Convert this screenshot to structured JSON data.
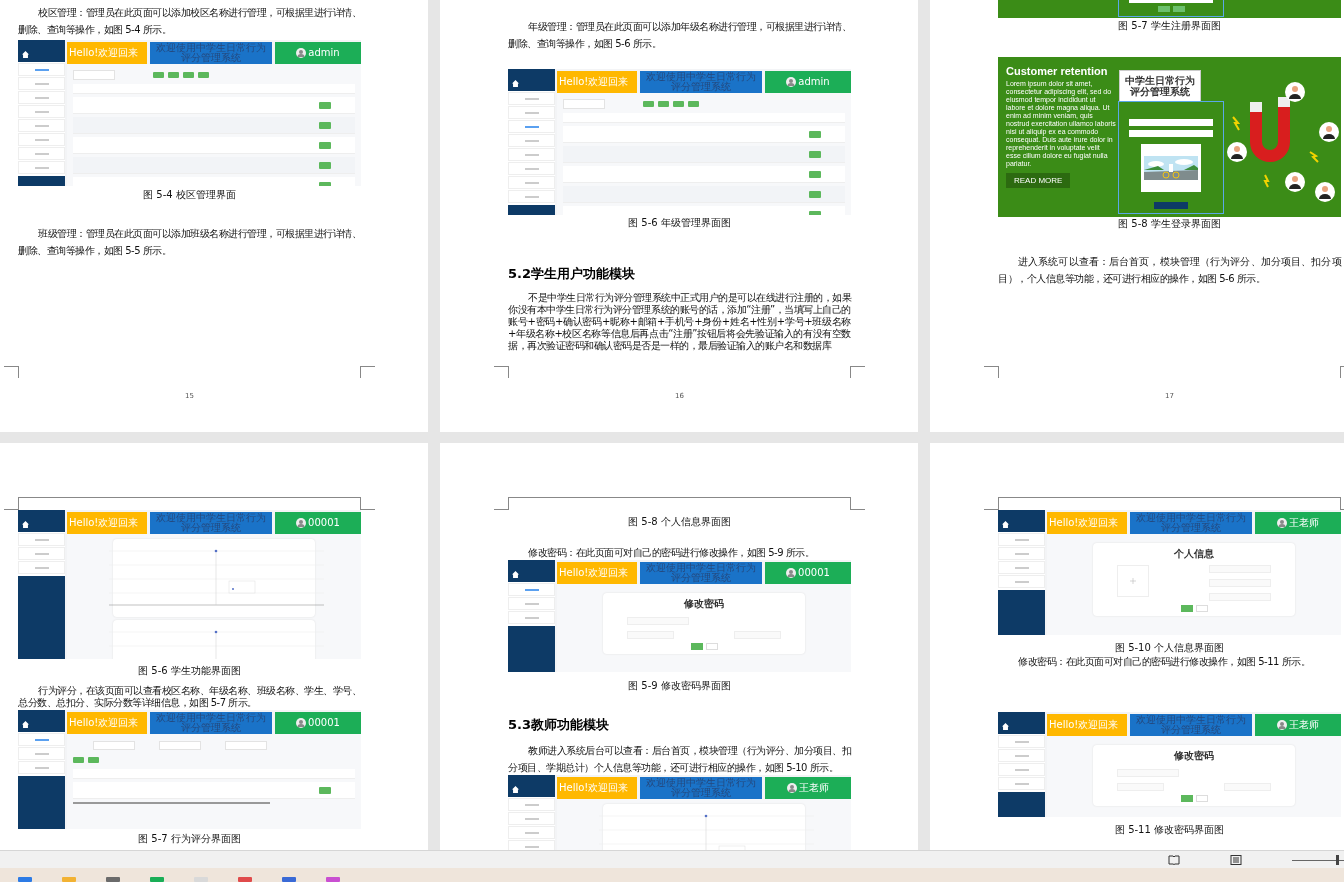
{
  "pages": [
    {
      "number": "15",
      "blocks": [
        {
          "kind": "paragraph",
          "text": "校区管理：管理员在此页面可以添加校区名称进行管理，可根据里进行详情、删除、查询等操作，如图 5-4 所示。"
        },
        {
          "kind": "table_screenshot",
          "greeting": "Hello!欢迎回来",
          "banner": "欢迎使用中学生日常行为评分管理系统",
          "user": "admin",
          "menu": [
            {
              "selected": true
            },
            {
              "selected": false
            },
            {
              "selected": false
            },
            {
              "selected": false
            },
            {
              "selected": false
            },
            {
              "selected": false
            },
            {
              "selected": false
            },
            {
              "selected": false
            }
          ]
        },
        {
          "kind": "caption",
          "text": "图 5-4 校区管理界面"
        },
        {
          "kind": "paragraph",
          "text": "班级管理：管理员在此页面可以添加班级名称进行管理，可根据里进行详情、删除、查询等操作，如图 5-5 所示。"
        }
      ]
    },
    {
      "number": "16",
      "blocks": [
        {
          "kind": "paragraph",
          "text": "年级管理：管理员在此页面可以添加年级名称进行管理，可根据里进行详情、删除、查询等操作，如图 5-6 所示。"
        },
        {
          "kind": "table_screenshot",
          "greeting": "Hello!欢迎回来",
          "banner": "欢迎使用中学生日常行为评分管理系统",
          "user": "admin",
          "menu": [
            {
              "selected": false
            },
            {
              "selected": false
            },
            {
              "selected": true
            },
            {
              "selected": false
            },
            {
              "selected": false
            },
            {
              "selected": false
            },
            {
              "selected": false
            },
            {
              "selected": false
            }
          ]
        },
        {
          "kind": "caption",
          "text": "图 5-6 年级管理界面图"
        },
        {
          "kind": "heading",
          "text": "5.2学生用户功能模块"
        },
        {
          "kind": "paragraph",
          "text": "不是中学生日常行为评分管理系统中正式用户的是可以在线进行注册的，如果你没有本中学生日常行为评分管理系统的账号的话，添加“注册”，当填写上自己的账号+密码+确认密码+昵称+邮箱+手机号+身份+姓名+性别+学号+班级名称+年级名称+校区名称等信息后再点击“注册”按钮后将会先验证输入的有没有空数据，再次验证密码和确认密码是否是一样的，最后验证输入的账户名和数据库"
        }
      ]
    },
    {
      "number": "17",
      "blocks": [
        {
          "kind": "register_tail"
        },
        {
          "kind": "caption",
          "text": "图 5-7 学生注册界面图"
        },
        {
          "kind": "login",
          "headline": "Customer retention",
          "body": "Lorem ipsum dolor sit amet, consectetur adipiscing elit, sed do eiusmod tempor incididunt ut labore et dolore magna aliqua. Ut enim ad minim veniam, quis nostrud exercitation ullamco laboris nisi ut aliquip ex ea commodo consequat. Duis aute irure dolor in reprehenderit in voluptate velit esse cillum dolore eu fugiat nulla pariatur.",
          "button": "READ MORE",
          "panel_title": "中学生日常行为评分管理系统"
        },
        {
          "kind": "caption",
          "text": "图 5-8 学生登录界面图"
        },
        {
          "kind": "paragraph",
          "text": "进入系统可以查看：后台首页，模块管理（行为评分、加分项目、扣分项目），个人信息等功能，还可进行相应的操作，如图 5-6 所示。"
        }
      ]
    },
    {
      "blocks": [
        {
          "kind": "chart_screenshot",
          "greeting": "Hello!欢迎回来",
          "banner": "欢迎使用中学生日常行为评分管理系统",
          "user": "00001",
          "menu": [
            {
              "selected": false
            },
            {
              "selected": false
            },
            {
              "selected": false
            }
          ]
        },
        {
          "kind": "caption",
          "text": "图 5-6 学生功能界面图"
        },
        {
          "kind": "paragraph",
          "text": "行为评分，在该页面可以查看校区名称、年级名称、班级名称、学生、学号、总分数、总扣分、实际分数等详细信息，如图 5-7 所示。"
        },
        {
          "kind": "filter_table_screenshot",
          "greeting": "Hello!欢迎回来",
          "banner": "欢迎使用中学生日常行为评分管理系统",
          "user": "00001",
          "menu": [
            {
              "selected": true
            },
            {
              "selected": false
            },
            {
              "selected": false
            }
          ]
        },
        {
          "kind": "caption",
          "text": "图 5-7 行为评分界面图"
        }
      ]
    },
    {
      "blocks": [
        {
          "kind": "caption",
          "text": "图 5-8 个人信息界面图"
        },
        {
          "kind": "paragraph",
          "text": "修改密码：在此页面可对自己的密码进行修改操作，如图 5-9 所示。"
        },
        {
          "kind": "password_screenshot",
          "title": "修改密码",
          "greeting": "Hello!欢迎回来",
          "banner": "欢迎使用中学生日常行为评分管理系统",
          "user": "00001",
          "menu": [
            {
              "selected": true
            },
            {
              "selected": false
            },
            {
              "selected": false
            }
          ]
        },
        {
          "kind": "caption",
          "text": "图 5-9 修改密码界面图"
        },
        {
          "kind": "heading",
          "text": "5.3教师功能模块"
        },
        {
          "kind": "paragraph",
          "text": "教师进入系统后台可以查看：后台首页，模块管理（行为评分、加分项目、扣分项目、学期总计）个人信息等功能，还可进行相应的操作，如图 5-10 所示。"
        },
        {
          "kind": "chart_screenshot",
          "greeting": "Hello!欢迎回来",
          "banner": "欢迎使用中学生日常行为评分管理系统",
          "user": "王老师",
          "menu": [
            {
              "selected": false
            },
            {
              "selected": false
            },
            {
              "selected": false
            },
            {
              "selected": false
            }
          ]
        }
      ]
    },
    {
      "blocks": [
        {
          "kind": "profile_screenshot",
          "title": "个人信息",
          "greeting": "Hello!欢迎回来",
          "banner": "欢迎使用中学生日常行为评分管理系统",
          "user": "王老师",
          "menu": [
            {
              "selected": false
            },
            {
              "selected": false
            },
            {
              "selected": false
            },
            {
              "selected": false
            }
          ]
        },
        {
          "kind": "caption",
          "text": "图 5-10 个人信息界面图"
        },
        {
          "kind": "paragraph",
          "text": "修改密码：在此页面可对自己的密码进行修改操作，如图 5-11 所示。"
        },
        {
          "kind": "password_screenshot",
          "title": "修改密码",
          "greeting": "Hello!欢迎回来",
          "banner": "欢迎使用中学生日常行为评分管理系统",
          "user": "王老师",
          "menu": [
            {
              "selected": false
            },
            {
              "selected": false
            },
            {
              "selected": false
            },
            {
              "selected": false
            }
          ]
        },
        {
          "kind": "caption",
          "text": "图 5-11 修改密码界面图"
        }
      ]
    }
  ],
  "status_bar": {
    "zoom_slider": {
      "level": 0.9
    }
  }
}
